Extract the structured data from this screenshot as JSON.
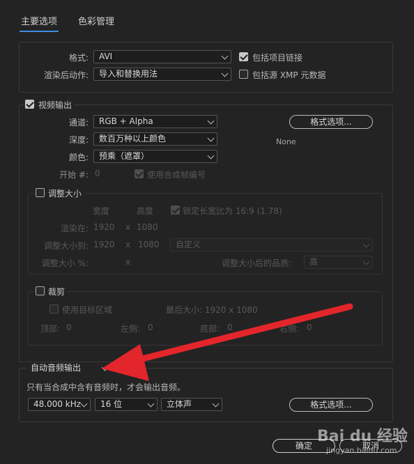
{
  "tabs": [
    {
      "label": "主要选项",
      "active": true
    },
    {
      "label": "色彩管理",
      "active": false
    }
  ],
  "main": {
    "format_label": "格式:",
    "format_value": "AVI",
    "post_render_label": "渲染后动作:",
    "post_render_value": "导入和替换用法",
    "include_project_link": "包括项目链接",
    "include_project_link_checked": true,
    "include_xmp": "包括源 XMP 元数据",
    "include_xmp_checked": false
  },
  "video": {
    "title": "视频输出",
    "checked": true,
    "channel_label": "通道:",
    "channel_value": "RGB + Alpha",
    "depth_label": "深度:",
    "depth_value": "数百万种以上颜色",
    "color_label": "颜色:",
    "color_value": "预乘（遮罩）",
    "start_label": "开始 #:",
    "start_value": "0",
    "use_comp_frame": "使用合成帧编号",
    "use_comp_frame_checked": true,
    "format_options_button": "格式选项...",
    "codec_text": "None"
  },
  "resize": {
    "title": "调整大小",
    "checked": false,
    "width_header": "宽度",
    "height_header": "高度",
    "lock_aspect": "锁定长宽比为 16:9 (1.78)",
    "lock_aspect_checked": true,
    "render_at_label": "渲染在:",
    "render_w": "1920",
    "render_h": "1080",
    "resize_to_label": "调整大小到:",
    "resize_w": "1920",
    "resize_h": "1080",
    "times": "x",
    "preset_value": "自定义",
    "resize_pct_label": "调整大小 %:",
    "quality_label": "调整大小后的品质:",
    "quality_value": "高"
  },
  "crop": {
    "title": "裁剪",
    "checked": false,
    "use_roi": "使用目标区域",
    "use_roi_checked": false,
    "final_size": "最后大小: 1920 x 1080",
    "top_label": "顶部:",
    "top_value": "0",
    "left_label": "左侧:",
    "left_value": "0",
    "bottom_label": "底部:",
    "bottom_value": "0",
    "right_label": "右侧:",
    "right_value": "0"
  },
  "audio": {
    "mode_value": "自动音频输出",
    "note": "只有当合成中含有音频时，才会输出音频。",
    "rate_value": "48.000 kHz",
    "bits_value": "16 位",
    "channels_value": "立体声",
    "format_options_button": "格式选项..."
  },
  "footer": {
    "ok_button": "确定",
    "cancel_button": "取消"
  },
  "watermark": {
    "brand": "Bai du 经验",
    "url": "jingyan.baidu.com"
  },
  "colors": {
    "accent": "#3a8ee6",
    "arrow": "#e3262b"
  }
}
